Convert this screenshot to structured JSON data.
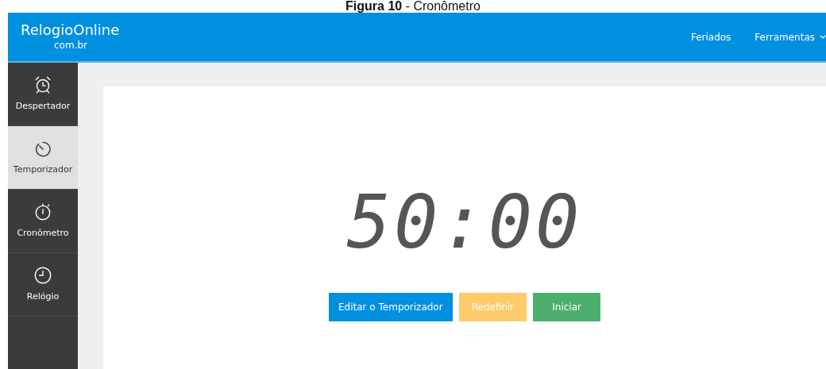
{
  "caption": "**Figura 10** - Cronômetro",
  "brand": {
    "name": "RelogioOnline",
    "domain": "com.br"
  },
  "nav_links": [
    {
      "label": "Feriados",
      "dropdown": false
    },
    {
      "label": "Ferramentas",
      "dropdown": true
    }
  ],
  "sidebar": {
    "items": [
      {
        "label": "Despertador",
        "kind": "alarm",
        "selected": false
      },
      {
        "label": "Temporizador",
        "kind": "timer",
        "selected": true
      },
      {
        "label": "Cronômetro",
        "kind": "stopwatch",
        "selected": false
      },
      {
        "label": "Relógio",
        "kind": "clock",
        "selected": false
      }
    ]
  },
  "display": "50:00",
  "buttons": [
    {
      "label": "Editar o Temporizador",
      "kind": "edit"
    },
    {
      "label": "Redefinir",
      "kind": "reset"
    },
    {
      "label": "Iniciar",
      "kind": "start"
    }
  ]
}
